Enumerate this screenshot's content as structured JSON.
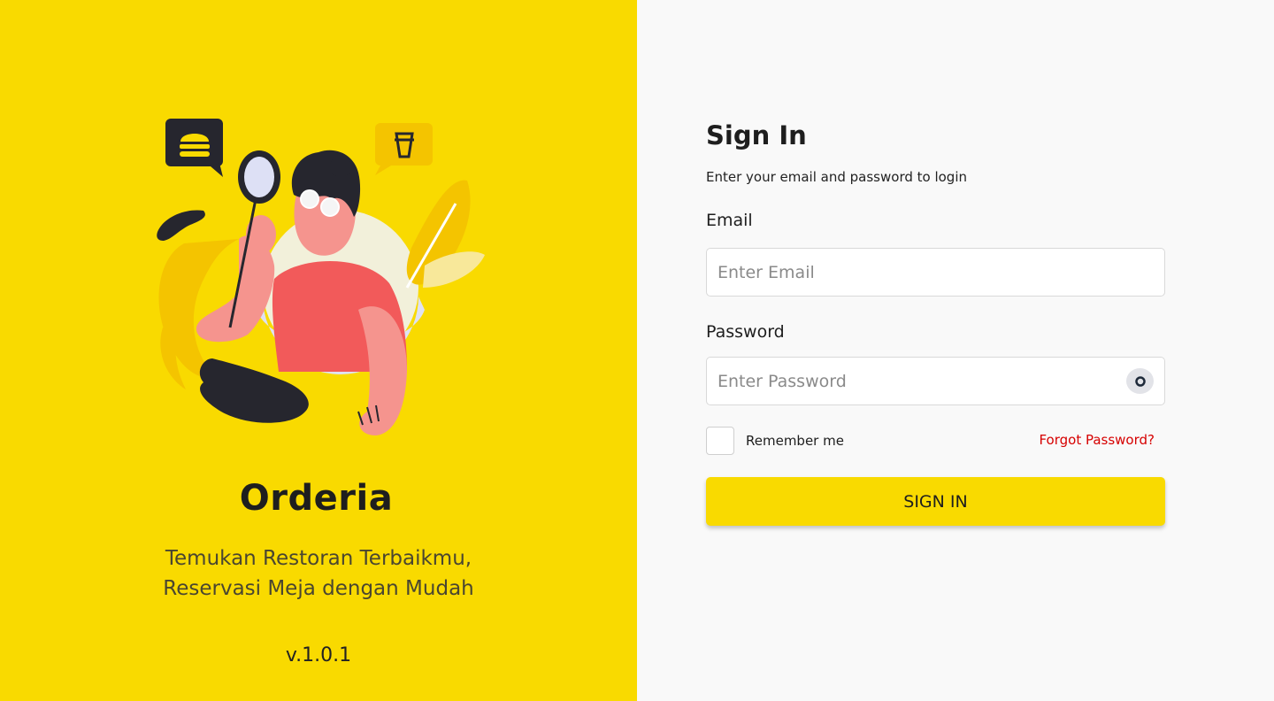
{
  "brand": {
    "name": "Orderia",
    "tagline_line1": "Temukan Restoran Terbaikmu,",
    "tagline_line2": "Reservasi Meja dengan Mudah",
    "version": "v.1.0.1"
  },
  "signin_form": {
    "title": "Sign In",
    "subtitle": "Enter your email and password to login",
    "email_label": "Email",
    "email_value": "",
    "email_placeholder": "Enter Email",
    "password_label": "Password",
    "password_value": "",
    "password_placeholder": "Enter Password",
    "password_toggle_icon": "eye-icon",
    "remember_label": "Remember me",
    "remember_checked": false,
    "forgot_label": "Forgot Password?",
    "submit_label": "SIGN IN"
  },
  "illustration": {
    "icons": [
      "burger-icon",
      "cup-icon",
      "magnifier-icon"
    ]
  },
  "colors": {
    "brand_yellow": "#f9da00",
    "link_red": "#d60000",
    "text_dark": "#1e1e1e",
    "panel_bg": "#f9f9f9"
  }
}
